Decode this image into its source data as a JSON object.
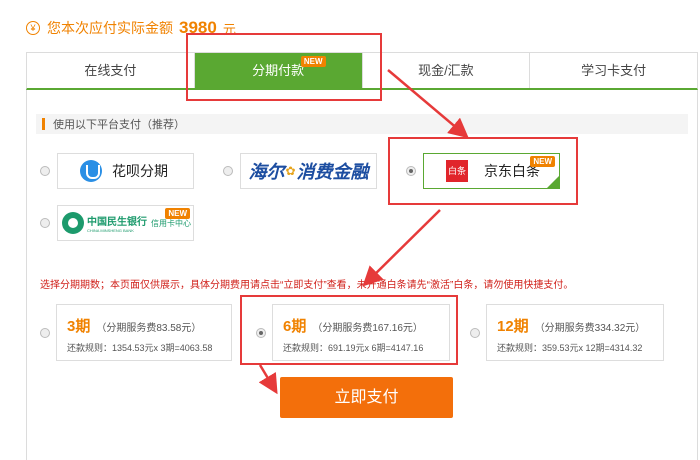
{
  "header": {
    "currency_symbol": "¥",
    "amount_label": "您本次应付实际金额",
    "amount_value": "3980",
    "amount_unit": "元"
  },
  "tabs": [
    {
      "label": "在线支付",
      "active": false
    },
    {
      "label": "分期付款",
      "active": true,
      "badge": "NEW"
    },
    {
      "label": "现金/汇款",
      "active": false
    },
    {
      "label": "学习卡支付",
      "active": false
    }
  ],
  "platform_section": {
    "title": "使用以下平台支付（推荐）"
  },
  "platforms": {
    "huabei": {
      "label": "花呗分期",
      "selected": false
    },
    "haier": {
      "label_left": "海尔",
      "label_right": "消费金融",
      "selected": false
    },
    "jd": {
      "label": "京东白条",
      "icon_text": "白条",
      "badge": "NEW",
      "selected": true
    },
    "minsheng": {
      "name_cn": "中国民生银行",
      "name_en": "CHINA MINSHENG BANK",
      "sub_label": "信用卡中心",
      "badge": "NEW",
      "selected": false
    }
  },
  "notice": {
    "text": "选择分期期数；本页面仅供展示，具体分期费用请点击“立即支付”查看，未开通白条请先“激活”白条，请勿使用快捷支付。"
  },
  "plans": [
    {
      "period": "3期",
      "fee": "（分期服务费83.58元）",
      "rule": "还款规则：1354.53元x 3期=4063.58",
      "selected": false
    },
    {
      "period": "6期",
      "fee": "（分期服务费167.16元）",
      "rule": "还款规则：691.19元x 6期=4147.16",
      "selected": true
    },
    {
      "period": "12期",
      "fee": "（分期服务费334.32元）",
      "rule": "还款规则：359.53元x 12期=4314.32",
      "selected": false
    }
  ],
  "pay_button": {
    "label": "立即支付"
  },
  "colors": {
    "accent_orange": "#f08200",
    "tab_green": "#5aa832",
    "annotation_red": "#e63a3a",
    "button_orange": "#f36f0b"
  }
}
